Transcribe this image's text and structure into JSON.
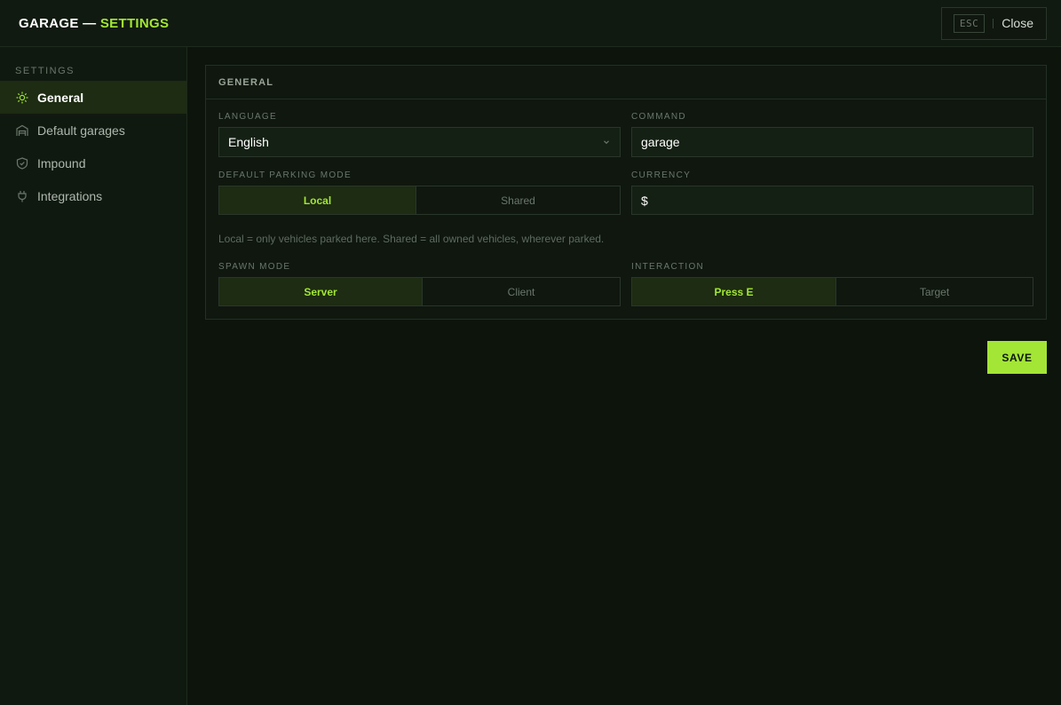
{
  "header": {
    "title_main": "GARAGE —",
    "title_accent": "SETTINGS",
    "esc_key": "ESC",
    "close_label": "Close"
  },
  "sidebar": {
    "heading": "SETTINGS",
    "items": [
      {
        "label": "General",
        "icon": "sun-icon",
        "active": true
      },
      {
        "label": "Default garages",
        "icon": "garage-icon",
        "active": false
      },
      {
        "label": "Impound",
        "icon": "shield-icon",
        "active": false
      },
      {
        "label": "Integrations",
        "icon": "plug-icon",
        "active": false
      }
    ]
  },
  "panel": {
    "title": "GENERAL",
    "language": {
      "label": "LANGUAGE",
      "value": "English"
    },
    "command": {
      "label": "COMMAND",
      "value": "garage"
    },
    "parking_mode": {
      "label": "DEFAULT PARKING MODE",
      "options": [
        "Local",
        "Shared"
      ],
      "selected": "Local"
    },
    "currency": {
      "label": "CURRENCY",
      "value": "$"
    },
    "hint": "Local = only vehicles parked here. Shared = all owned vehicles, wherever parked.",
    "spawn_mode": {
      "label": "SPAWN MODE",
      "options": [
        "Server",
        "Client"
      ],
      "selected": "Server"
    },
    "interaction": {
      "label": "INTERACTION",
      "options": [
        "Press E",
        "Target"
      ],
      "selected": "Press E"
    }
  },
  "save_label": "SAVE",
  "colors": {
    "accent": "#a3e635",
    "background": "#0c140c",
    "active_bg": "#1d2c12"
  }
}
